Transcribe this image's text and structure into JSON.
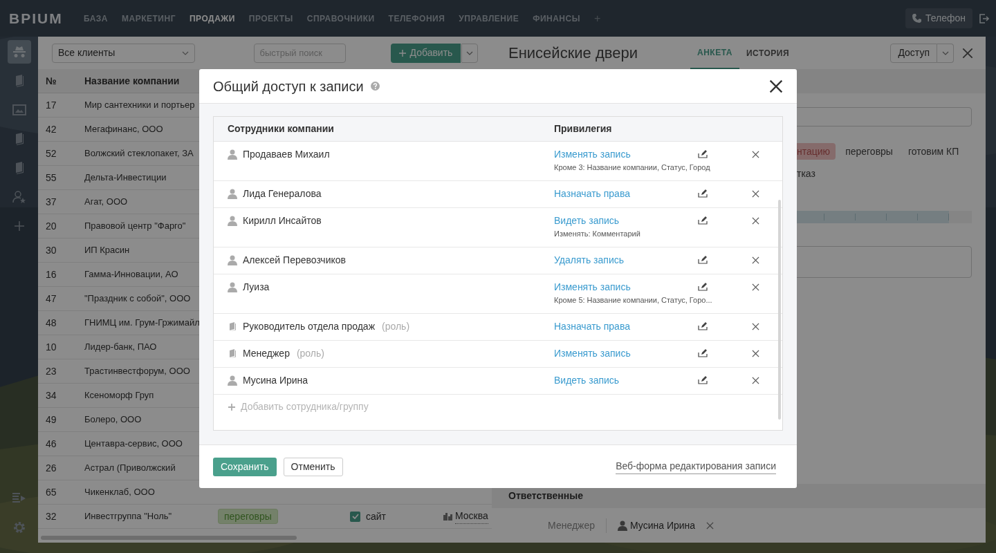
{
  "top_nav": {
    "logo": "BPIUM",
    "items": [
      {
        "label": "БАЗА",
        "selected": false
      },
      {
        "label": "МАРКЕТИНГ",
        "selected": false
      },
      {
        "label": "ПРОДАЖИ",
        "selected": true
      },
      {
        "label": "ПРОЕКТЫ",
        "selected": false
      },
      {
        "label": "СПРАВОЧНИКИ",
        "selected": false
      },
      {
        "label": "ТЕЛЕФОНИЯ",
        "selected": false
      },
      {
        "label": "УПРАВЛЕНИЕ",
        "selected": false
      },
      {
        "label": "ФИНАНСЫ",
        "selected": false
      }
    ],
    "add": "+",
    "phone_button": "Телефон"
  },
  "sidebar": {
    "top_items": [
      {
        "selected": true
      },
      {
        "selected": false
      },
      {
        "selected": false
      },
      {
        "selected": false
      },
      {
        "selected": false
      },
      {
        "selected": false
      },
      {
        "selected": false
      }
    ],
    "bottom_items": [
      {
        "selected": false
      },
      {
        "selected": false
      }
    ]
  },
  "list_panel": {
    "filter": "Все клиенты",
    "search": {
      "placeholder": "быстрый поиск"
    },
    "add_button": "Добавить",
    "columns": [
      "№",
      "Название компании"
    ],
    "rows": [
      {
        "number": "17",
        "name": "Мир сантехники и портьер"
      },
      {
        "number": "42",
        "name": "Мегафинанс, ООО"
      },
      {
        "number": "52",
        "name": "Волжский стеклопакет, ЗА"
      },
      {
        "number": "55",
        "name": "Дельта-Инвестиции"
      },
      {
        "number": "37",
        "name": "Агат, ООО"
      },
      {
        "number": "20",
        "name": "Правовой центр \"Фарго\""
      },
      {
        "number": "30",
        "name": "ИП Красин"
      },
      {
        "number": "16",
        "name": "Гамма-Инновации, АО"
      },
      {
        "number": "47",
        "name": "\"Праздник с собой\", ООО"
      },
      {
        "number": "48",
        "name": "ГНИМЦ им. Грум-Гржимайл"
      },
      {
        "number": "10",
        "name": "Лидер-банк, ПАО"
      },
      {
        "number": "23",
        "name": "Трастинвестфорум, ООО"
      },
      {
        "number": "34",
        "name": "Ксеноморф Груп"
      },
      {
        "number": "49",
        "name": "Болеро, ООО"
      },
      {
        "number": "46",
        "name": "Центавра-сервис, ООО"
      },
      {
        "number": "26",
        "name": "Астрал (Приволжский"
      },
      {
        "number": "65",
        "name": "Чикенклаб, ООО"
      },
      {
        "number": "32",
        "name": "Инвестгруппа \"Ноль\"",
        "status": "переговры",
        "channel": {
          "label": "сайт",
          "checked": true
        },
        "city": "Москва"
      }
    ]
  },
  "record_panel": {
    "title": "Енисейские двери",
    "tabs": [
      {
        "label": "АНКЕТА",
        "selected": true
      },
      {
        "label": "ИСТОРИЯ",
        "selected": false
      }
    ],
    "access_button": "Доступ",
    "stage_rows": [
      [
        {
          "label": "нтацию",
          "selected": true
        },
        {
          "label": "переговры",
          "selected": false
        },
        {
          "label": "готовим КП",
          "selected": false
        }
      ],
      [
        {
          "label": "тказ",
          "selected": false
        }
      ]
    ],
    "progress": {
      "level": 0.95
    },
    "responsible_section": "Ответственные",
    "responsible": {
      "role": "Менеджер",
      "person": "Мусина Ирина"
    }
  },
  "dialog": {
    "title": "Общий доступ к записи",
    "columns": [
      "Сотрудники компании",
      "Привилегия"
    ],
    "entries": [
      {
        "kind": "user",
        "name": "Продаваев Михаил",
        "privilege": "Изменять запись",
        "note": "Кроме 3: Название компании, Статус, Город"
      },
      {
        "kind": "user",
        "name": "Лида Генералова",
        "privilege": "Назначать права"
      },
      {
        "kind": "user",
        "name": "Кирилл Инсайтов",
        "privilege": "Видеть запись",
        "note": "Изменять: Комментарий"
      },
      {
        "kind": "user",
        "name": "Алексей Перевозчиков",
        "privilege": "Удалять запись"
      },
      {
        "kind": "user",
        "name": "Луиза",
        "privilege": "Изменять запись",
        "note": "Кроме 5: Название компании, Статус, Горо..."
      },
      {
        "kind": "role",
        "name": "Руководитель отдела продаж",
        "role_label": "(роль)",
        "privilege": "Назначать права"
      },
      {
        "kind": "role",
        "name": "Менеджер",
        "role_label": "(роль)",
        "privilege": "Изменять запись"
      },
      {
        "kind": "user",
        "name": "Мусина Ирина",
        "privilege": "Видеть запись"
      }
    ],
    "add_entry": "Добавить сотрудника/группу",
    "save_button": "Сохранить",
    "cancel_button": "Отменить",
    "web_form_link": "Веб-форма редактирования записи"
  }
}
